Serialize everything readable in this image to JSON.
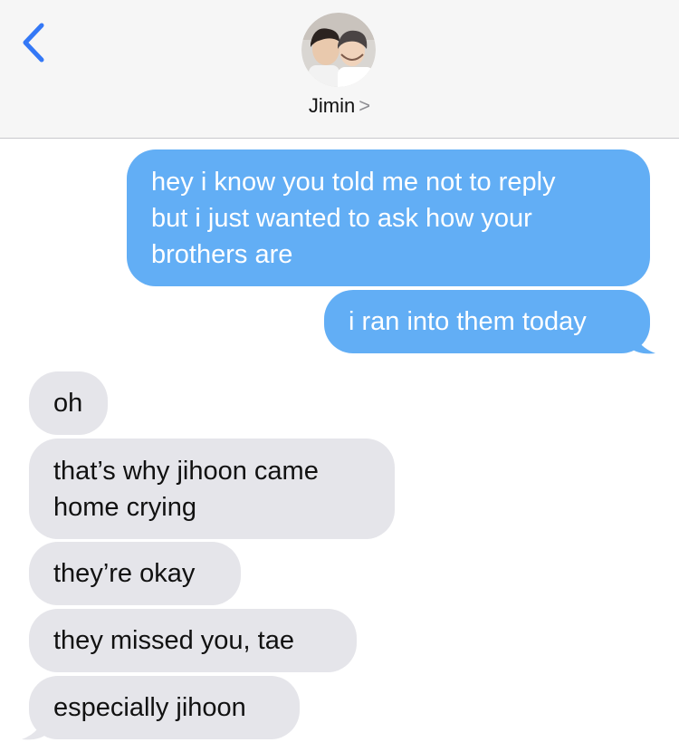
{
  "header": {
    "back_icon": "chevron-left-icon",
    "contact_name": "Jimin",
    "chevron": ">",
    "accent_color": "#3478f6"
  },
  "messages": [
    {
      "direction": "sent",
      "text": "hey i know you told me not to reply\nbut i just wanted to ask how your\nbrothers are"
    },
    {
      "direction": "sent",
      "text": "i ran into them today"
    },
    {
      "direction": "received",
      "text": "oh"
    },
    {
      "direction": "received",
      "text": "that’s why jihoon came\nhome crying"
    },
    {
      "direction": "received",
      "text": "they’re okay"
    },
    {
      "direction": "received",
      "text": "they missed you, tae"
    },
    {
      "direction": "received",
      "text": "especially jihoon"
    }
  ],
  "colors": {
    "sent_bubble": "#62aef5",
    "received_bubble": "#e5e5ea",
    "header_bg": "#f6f6f6"
  }
}
